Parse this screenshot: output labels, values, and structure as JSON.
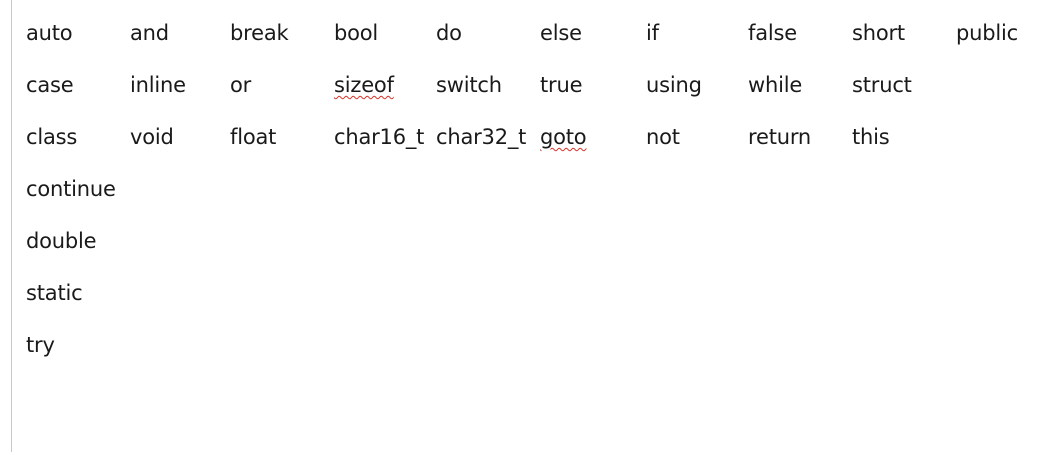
{
  "document": {
    "rows": [
      [
        {
          "text": "auto"
        },
        {
          "text": "and"
        },
        {
          "text": "break"
        },
        {
          "text": "bool"
        },
        {
          "text": "do"
        },
        {
          "text": "else"
        },
        {
          "text": "if"
        },
        {
          "text": "false"
        },
        {
          "text": "short"
        },
        {
          "text": "public"
        }
      ],
      [
        {
          "text": "case"
        },
        {
          "text": "inline"
        },
        {
          "text": "or"
        },
        {
          "text": "sizeof",
          "spell_error": true
        },
        {
          "text": "switch"
        },
        {
          "text": "true"
        },
        {
          "text": "using"
        },
        {
          "text": "while"
        },
        {
          "text": "struct"
        }
      ],
      [
        {
          "text": "class"
        },
        {
          "text": "void"
        },
        {
          "text": "float"
        },
        {
          "text": "char16_t"
        },
        {
          "text": "char32_t"
        },
        {
          "text": "goto",
          "spell_error": true
        },
        {
          "text": "not"
        },
        {
          "text": "return"
        },
        {
          "text": "this"
        }
      ],
      [
        {
          "text": "continue"
        }
      ],
      [
        {
          "text": "double"
        }
      ],
      [
        {
          "text": "static"
        }
      ],
      [
        {
          "text": "try"
        }
      ]
    ],
    "text_color": "#1a1a1a",
    "spell_underline_color": "#d93025"
  }
}
